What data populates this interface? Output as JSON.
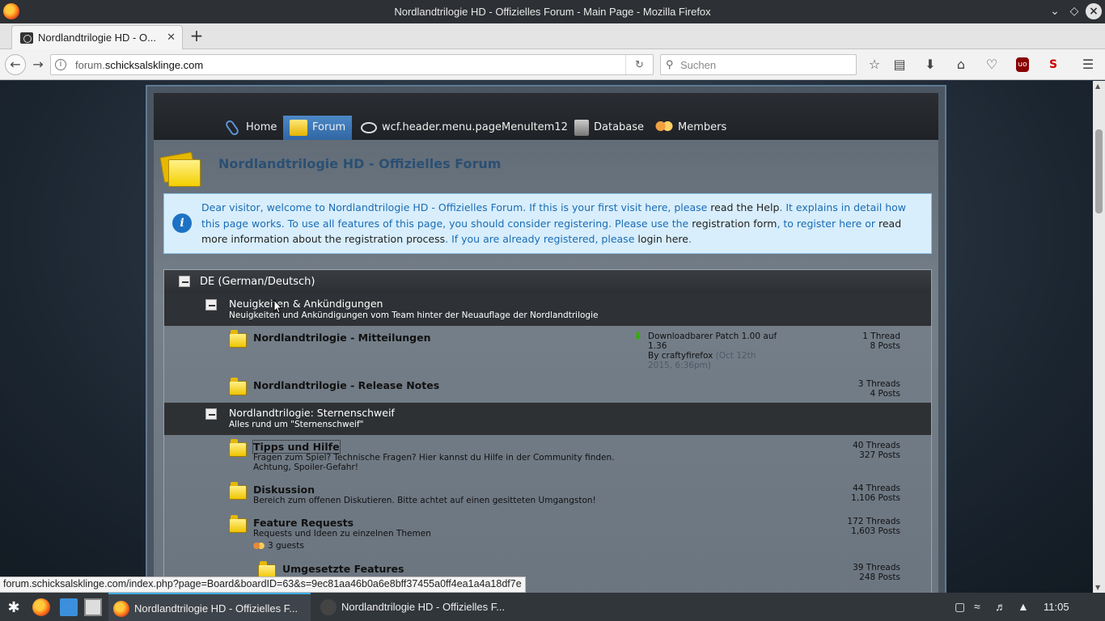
{
  "window": {
    "title": "Nordlandtrilogie HD - Offizielles Forum - Main Page - Mozilla Firefox"
  },
  "tabs": [
    {
      "label": "Nordlandtrilogie HD - O..."
    }
  ],
  "navbar": {
    "url_host": "forum.",
    "url_domain": "schicksalsklinge.com",
    "search_placeholder": "Suchen"
  },
  "forum": {
    "menu": [
      {
        "label": "Home",
        "icon": "paperclip-icon"
      },
      {
        "label": "Forum",
        "icon": "folder-icon",
        "active": true
      },
      {
        "label": "wcf.header.menu.pageMenuItem12",
        "icon": "eye-icon"
      },
      {
        "label": "Database",
        "icon": "database-icon"
      },
      {
        "label": "Members",
        "icon": "users-icon"
      }
    ],
    "page_title": "Nordlandtrilogie HD - Offizielles Forum",
    "notice": {
      "part1": "Dear visitor, welcome to Nordlandtrilogie HD - Offizielles Forum. If this is your first visit here, please ",
      "link1": "read the Help",
      "part2": ". It explains in detail how this page works. To use all features of this page, you should consider registering. Please use the ",
      "link2": "registration form",
      "part3": ", to register here or ",
      "link3": "read more information about the registration process",
      "part4": ". If you are already registered, please ",
      "link4": "login here",
      "part5": "."
    },
    "category": "DE (German/Deutsch)",
    "sections": [
      {
        "title": "Neuigkeiten & Ankündigungen",
        "desc": "Neuigkeiten und Ankündigungen vom Team hinter der Neuauflage der Nordlandtrilogie",
        "boards": [
          {
            "title": "Nordlandtrilogie - Mitteilungen",
            "last_post_title": "Downloadbarer Patch 1.00 auf 1.36",
            "last_post_by": "By craftyfirefox",
            "last_post_date": "(Oct 12th 2015, 6:36pm)",
            "threads": "1 Thread",
            "posts": "8 Posts"
          },
          {
            "title": "Nordlandtrilogie - Release Notes",
            "threads": "3 Threads",
            "posts": "4 Posts"
          }
        ]
      },
      {
        "title": "Nordlandtrilogie: Sternenschweif",
        "desc": "Alles rund um \"Sternenschweif\"",
        "boards": [
          {
            "title": "Tipps und Hilfe",
            "desc": "Fragen zum Spiel? Technische Fragen? Hier kannst du Hilfe in der Community finden. Achtung, Spoiler-Gefahr!",
            "threads": "40 Threads",
            "posts": "327 Posts"
          },
          {
            "title": "Diskussion",
            "desc": "Bereich zum offenen Diskutieren. Bitte achtet auf einen gesitteten Umgangston!",
            "threads": "44 Threads",
            "posts": "1,106 Posts"
          },
          {
            "title": "Feature Requests",
            "desc": "Requests und Ideen zu einzelnen Themen",
            "guests": "3 guests",
            "threads": "172 Threads",
            "posts": "1,603 Posts"
          },
          {
            "title": "Umgesetzte Features",
            "threads": "39 Threads",
            "posts": "248 Posts"
          }
        ]
      }
    ]
  },
  "status_url": "forum.schicksalsklinge.com/index.php?page=Board&boardID=63&s=9ec81aa46b0a6e8bff37455a0ff4ea1a4a18df7e",
  "taskbar": {
    "tasks": [
      {
        "label": "Nordlandtrilogie HD - Offizielles F..."
      },
      {
        "label": "Nordlandtrilogie HD - Offizielles F..."
      }
    ],
    "clock": "11:05"
  }
}
